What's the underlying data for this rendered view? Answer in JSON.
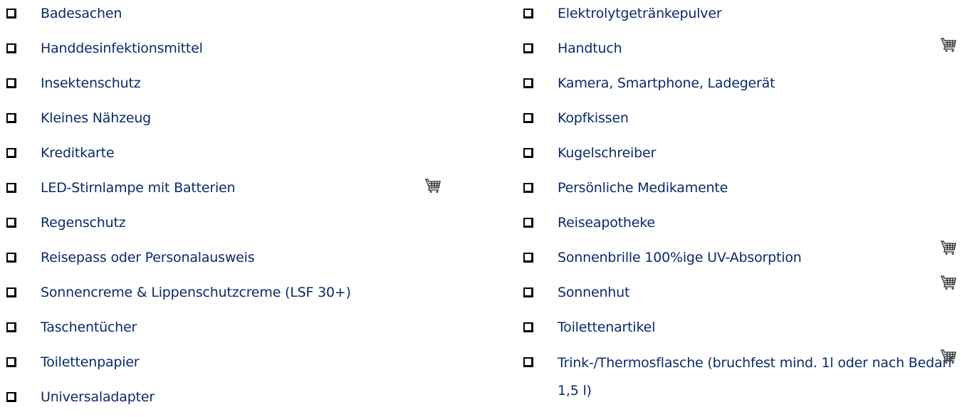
{
  "left_items": [
    {
      "label": "Badesachen",
      "cart": false
    },
    {
      "label": "Handdesinfektionsmittel",
      "cart": false
    },
    {
      "label": "Insektenschutz",
      "cart": false
    },
    {
      "label": "Kleines Nähzeug",
      "cart": false
    },
    {
      "label": "Kreditkarte",
      "cart": false
    },
    {
      "label": "LED-Stirnlampe mit Batterien",
      "cart": true
    },
    {
      "label": "Regenschutz",
      "cart": false
    },
    {
      "label": "Reisepass oder Personalausweis",
      "cart": false
    },
    {
      "label": "Sonnencreme & Lippenschutzcreme (LSF 30+)",
      "cart": false
    },
    {
      "label": "Taschentücher",
      "cart": false
    },
    {
      "label": "Toilettenpapier",
      "cart": false
    },
    {
      "label": "Universaladapter",
      "cart": false
    }
  ],
  "right_items": [
    {
      "label": "Elektrolytgetränkepulver",
      "cart": false
    },
    {
      "label": "Handtuch",
      "cart": true
    },
    {
      "label": "Kamera, Smartphone, Ladegerät",
      "cart": false
    },
    {
      "label": "Kopfkissen",
      "cart": false
    },
    {
      "label": "Kugelschreiber",
      "cart": false
    },
    {
      "label": "Persönliche Medikamente",
      "cart": false
    },
    {
      "label": "Reiseapotheke",
      "cart": false
    },
    {
      "label": "Sonnenbrille 100%ige UV-Absorption",
      "cart": true
    },
    {
      "label": "Sonnenhut",
      "cart": true
    },
    {
      "label": "Toilettenartikel",
      "cart": false
    },
    {
      "label": "Trink-/Thermosflasche (bruchfest mind. 1l oder nach Bedarf 1,5 l)",
      "cart": true
    }
  ],
  "icons": {
    "checkbox": "checkbox-icon",
    "cart": "shopping-cart-icon"
  },
  "colors": {
    "text": "#0b2a6b",
    "checkbox_border": "#000000",
    "cart": "#444444"
  }
}
